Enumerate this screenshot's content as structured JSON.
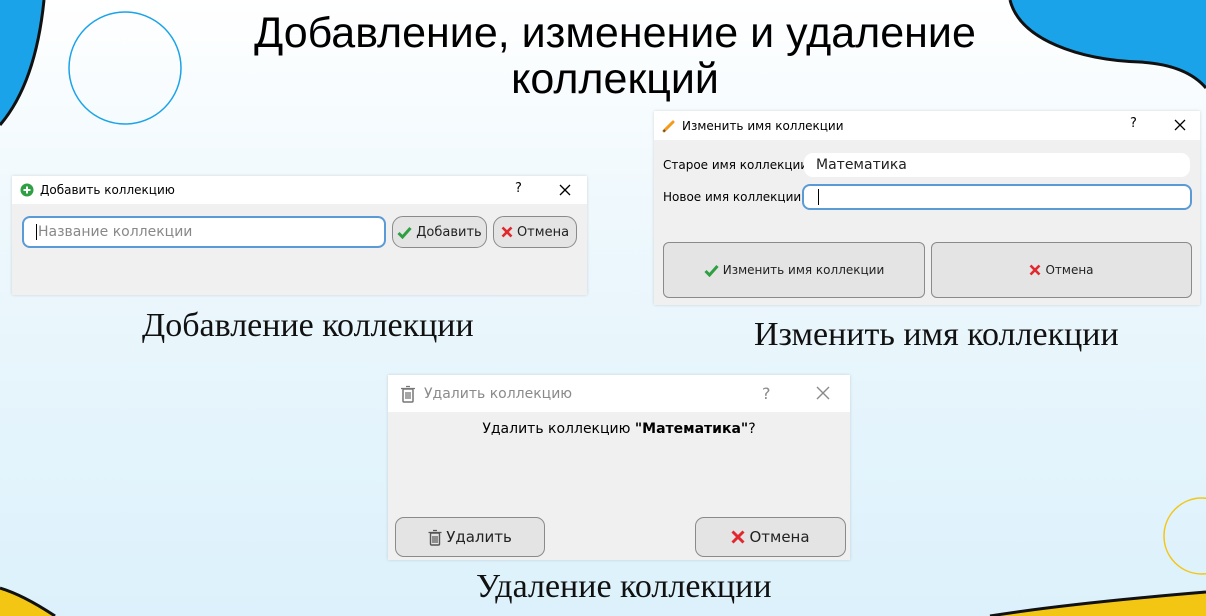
{
  "slide": {
    "title": "Добавление, изменение и удаление коллекций"
  },
  "add_dialog": {
    "title": "Добавить коллекцию",
    "help": "?",
    "input_placeholder": "Название коллекции",
    "add_button": "Добавить",
    "cancel_button": "Отмена",
    "caption": "Добавление коллекции"
  },
  "rename_dialog": {
    "title": "Изменить имя коллекции",
    "help": "?",
    "old_name_label": "Старое имя коллекции",
    "old_name_value": "Математика",
    "new_name_label": "Новое имя коллекции",
    "new_name_value": "",
    "confirm_button": "Изменить имя коллекции",
    "cancel_button": "Отмена",
    "caption": "Изменить имя коллекции"
  },
  "delete_dialog": {
    "title": "Удалить коллекцию",
    "help": "?",
    "message_prefix": "Удалить коллекцию ",
    "message_name": "\"Математика\"",
    "message_suffix": "?",
    "delete_button": "Удалить",
    "cancel_button": "Отмена",
    "caption": "Удаление коллекции"
  },
  "colors": {
    "accent_blue": "#1aa3e8",
    "accent_yellow": "#f3c614",
    "input_border": "#5b9bd5",
    "check_green": "#2ea043",
    "cross_red": "#e0282e"
  },
  "icons": [
    "plus-circle-icon",
    "pencil-icon",
    "trash-icon",
    "check-icon",
    "cross-icon",
    "close-icon"
  ]
}
